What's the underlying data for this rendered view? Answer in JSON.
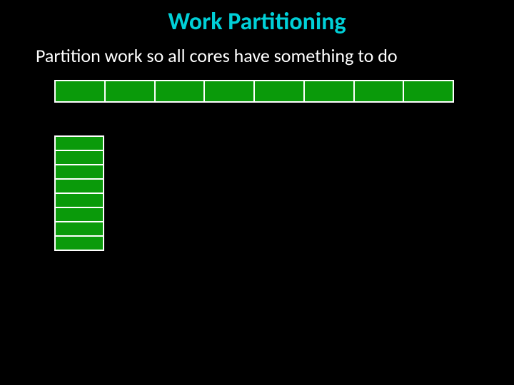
{
  "title": "Work Partitioning",
  "subtitle": "Partition work so all cores have something to do",
  "horizontal_partitions": 8,
  "vertical_partitions": 8,
  "colors": {
    "background": "#000000",
    "title": "#00d0d8",
    "text": "#ffffff",
    "bar_border": "#ffffff",
    "cell_fill": "#0a9a0a"
  },
  "chart_data": {
    "type": "table",
    "title": "Work Partitioning diagram",
    "description": "Two bars each divided into equal green segments representing work split across cores",
    "bars": [
      {
        "orientation": "horizontal",
        "segments": 8
      },
      {
        "orientation": "vertical",
        "segments": 8
      }
    ]
  }
}
